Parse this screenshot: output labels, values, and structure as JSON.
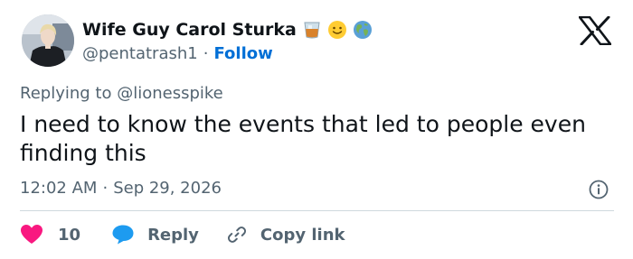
{
  "author": {
    "display_name": "Wife Guy Carol Sturka",
    "handle": "@pentatrash1",
    "follow_label": "Follow",
    "emojis": [
      "tumbler-glass-emoji",
      "smiling-face-emoji",
      "globe-emoji"
    ]
  },
  "reply_context": {
    "prefix": "Replying to",
    "mention": "@lionesspike"
  },
  "tweet": {
    "text": "I need to know the events that led to people even finding this",
    "time": "12:02 AM",
    "separator": "·",
    "date": "Sep 29, 2026"
  },
  "actions": {
    "like_count": "10",
    "reply_label": "Reply",
    "copy_label": "Copy link"
  },
  "colors": {
    "like": "#f91880",
    "reply": "#1d9bf0",
    "follow": "#006fd6",
    "muted": "#536471",
    "text": "#0f1419"
  }
}
